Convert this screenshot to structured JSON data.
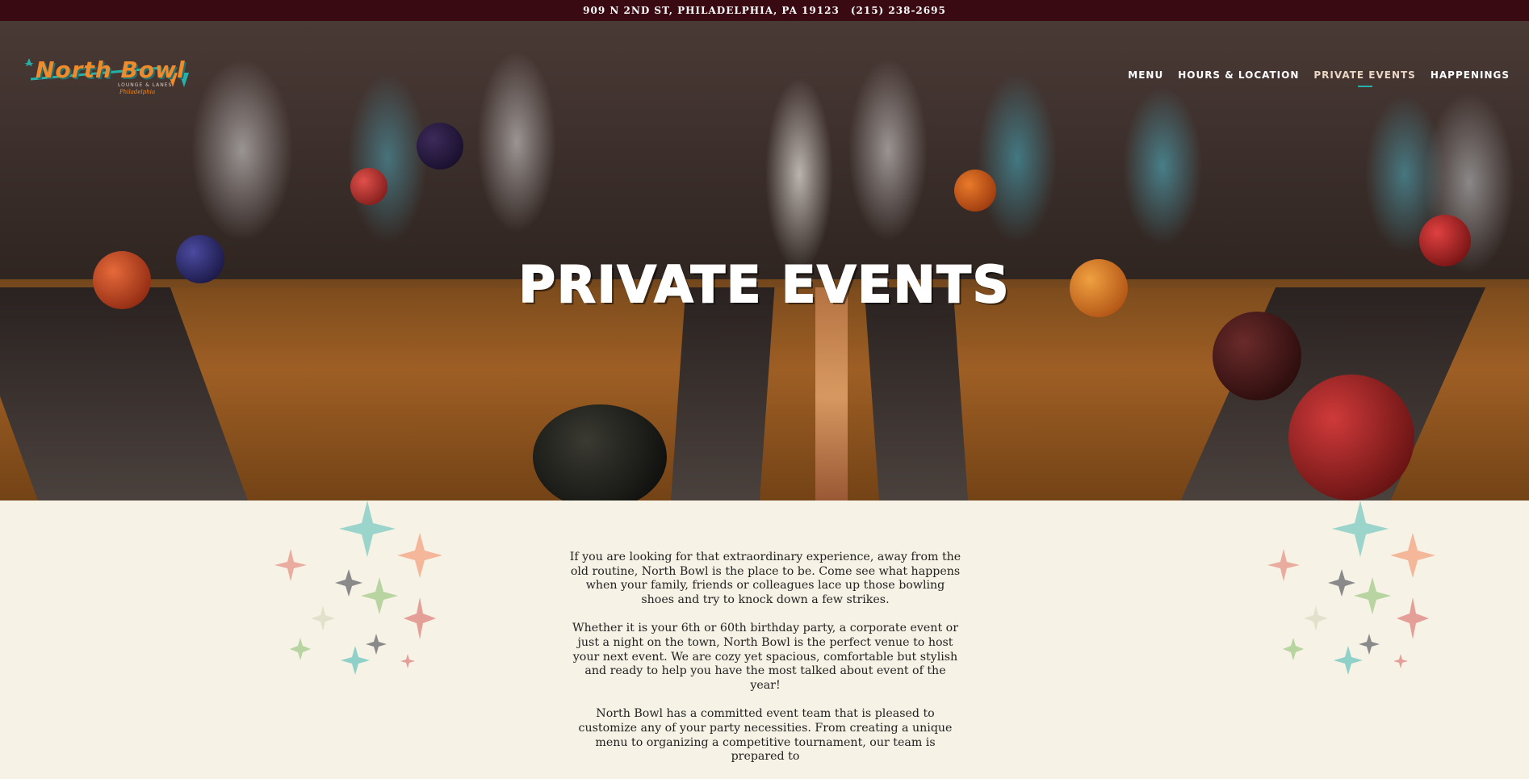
{
  "topbar": {
    "address": "909 N 2ND ST, PHILADELPHIA, PA 19123",
    "phone": "(215) 238-2695"
  },
  "logo": {
    "name": "North Bowl",
    "sub": "LOUNGE & LANES",
    "tag": "Philadelphia"
  },
  "nav": {
    "items": [
      {
        "label": "MENU"
      },
      {
        "label": "HOURS & LOCATION"
      },
      {
        "label": "PRIVATE EVENTS",
        "active": true
      },
      {
        "label": "HAPPENINGS"
      }
    ]
  },
  "hero": {
    "title": "PRIVATE EVENTS"
  },
  "content": {
    "paragraphs": [
      "If you are looking for that extraordinary experience, away from the old routine, North Bowl is the place to be. Come see what happens when your family, friends or colleagues lace up those bowling shoes and try to knock down a few strikes.",
      "Whether it is your 6th or 60th birthday party, a corporate event or just a night on the town, North Bowl is the perfect venue to host your next event. We are cozy yet spacious, comfortable but stylish and ready to help you have the most talked about event of the year!",
      "North Bowl has a committed event team that is pleased to customize any of your party necessities. From creating a unique menu to organizing a competitive tournament, our team is prepared to"
    ]
  },
  "colors": {
    "topbar_bg": "#3a0a13",
    "page_bg": "#f7f2e6",
    "accent_teal": "#27b0a8",
    "logo_orange": "#f08a2a"
  }
}
